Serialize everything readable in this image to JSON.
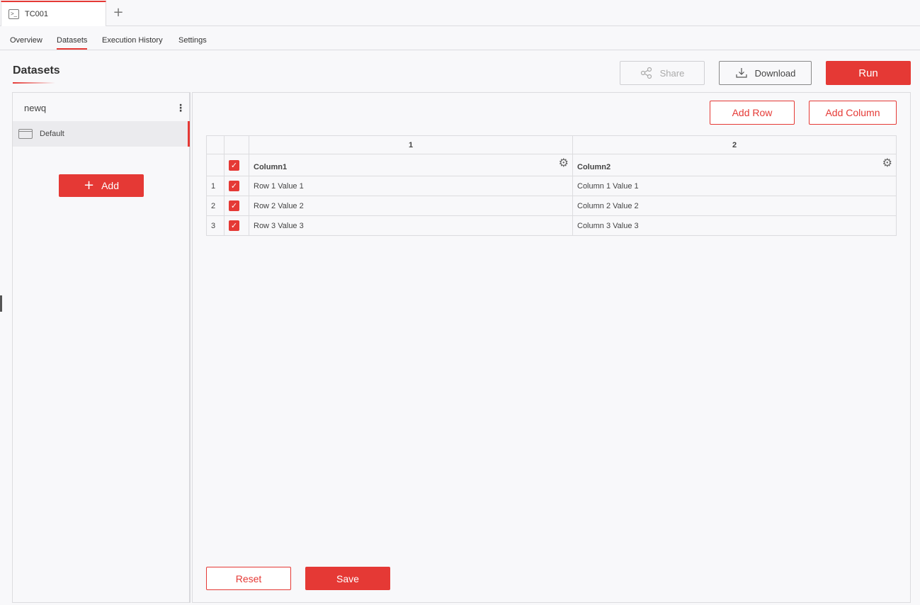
{
  "tabs": {
    "active_tab": "TC001",
    "new_tab_symbol": "+"
  },
  "subnav": [
    "Overview",
    "Datasets",
    "Execution History",
    "Settings"
  ],
  "page": {
    "title": "Datasets"
  },
  "toolbar": {
    "share": "Share",
    "download": "Download",
    "run": "Run"
  },
  "sidebar": {
    "dataset_name": "newq",
    "items": [
      {
        "label": "Default"
      }
    ],
    "add": "Add"
  },
  "grid": {
    "add_row": "Add Row",
    "add_column": "Add Column",
    "column_numbers": [
      "1",
      "2"
    ],
    "columns": [
      "Column1",
      "Column2"
    ],
    "rows": [
      {
        "index": "1",
        "checked": true,
        "values": [
          "Row 1 Value 1",
          "Column 1 Value 1"
        ]
      },
      {
        "index": "2",
        "checked": true,
        "values": [
          "Row 2 Value 2",
          "Column 2 Value 2"
        ]
      },
      {
        "index": "3",
        "checked": true,
        "values": [
          "Row 3 Value 3",
          "Column 3 Value 3"
        ]
      }
    ],
    "reset": "Reset",
    "save": "Save"
  },
  "colors": {
    "accent": "#e53935"
  }
}
